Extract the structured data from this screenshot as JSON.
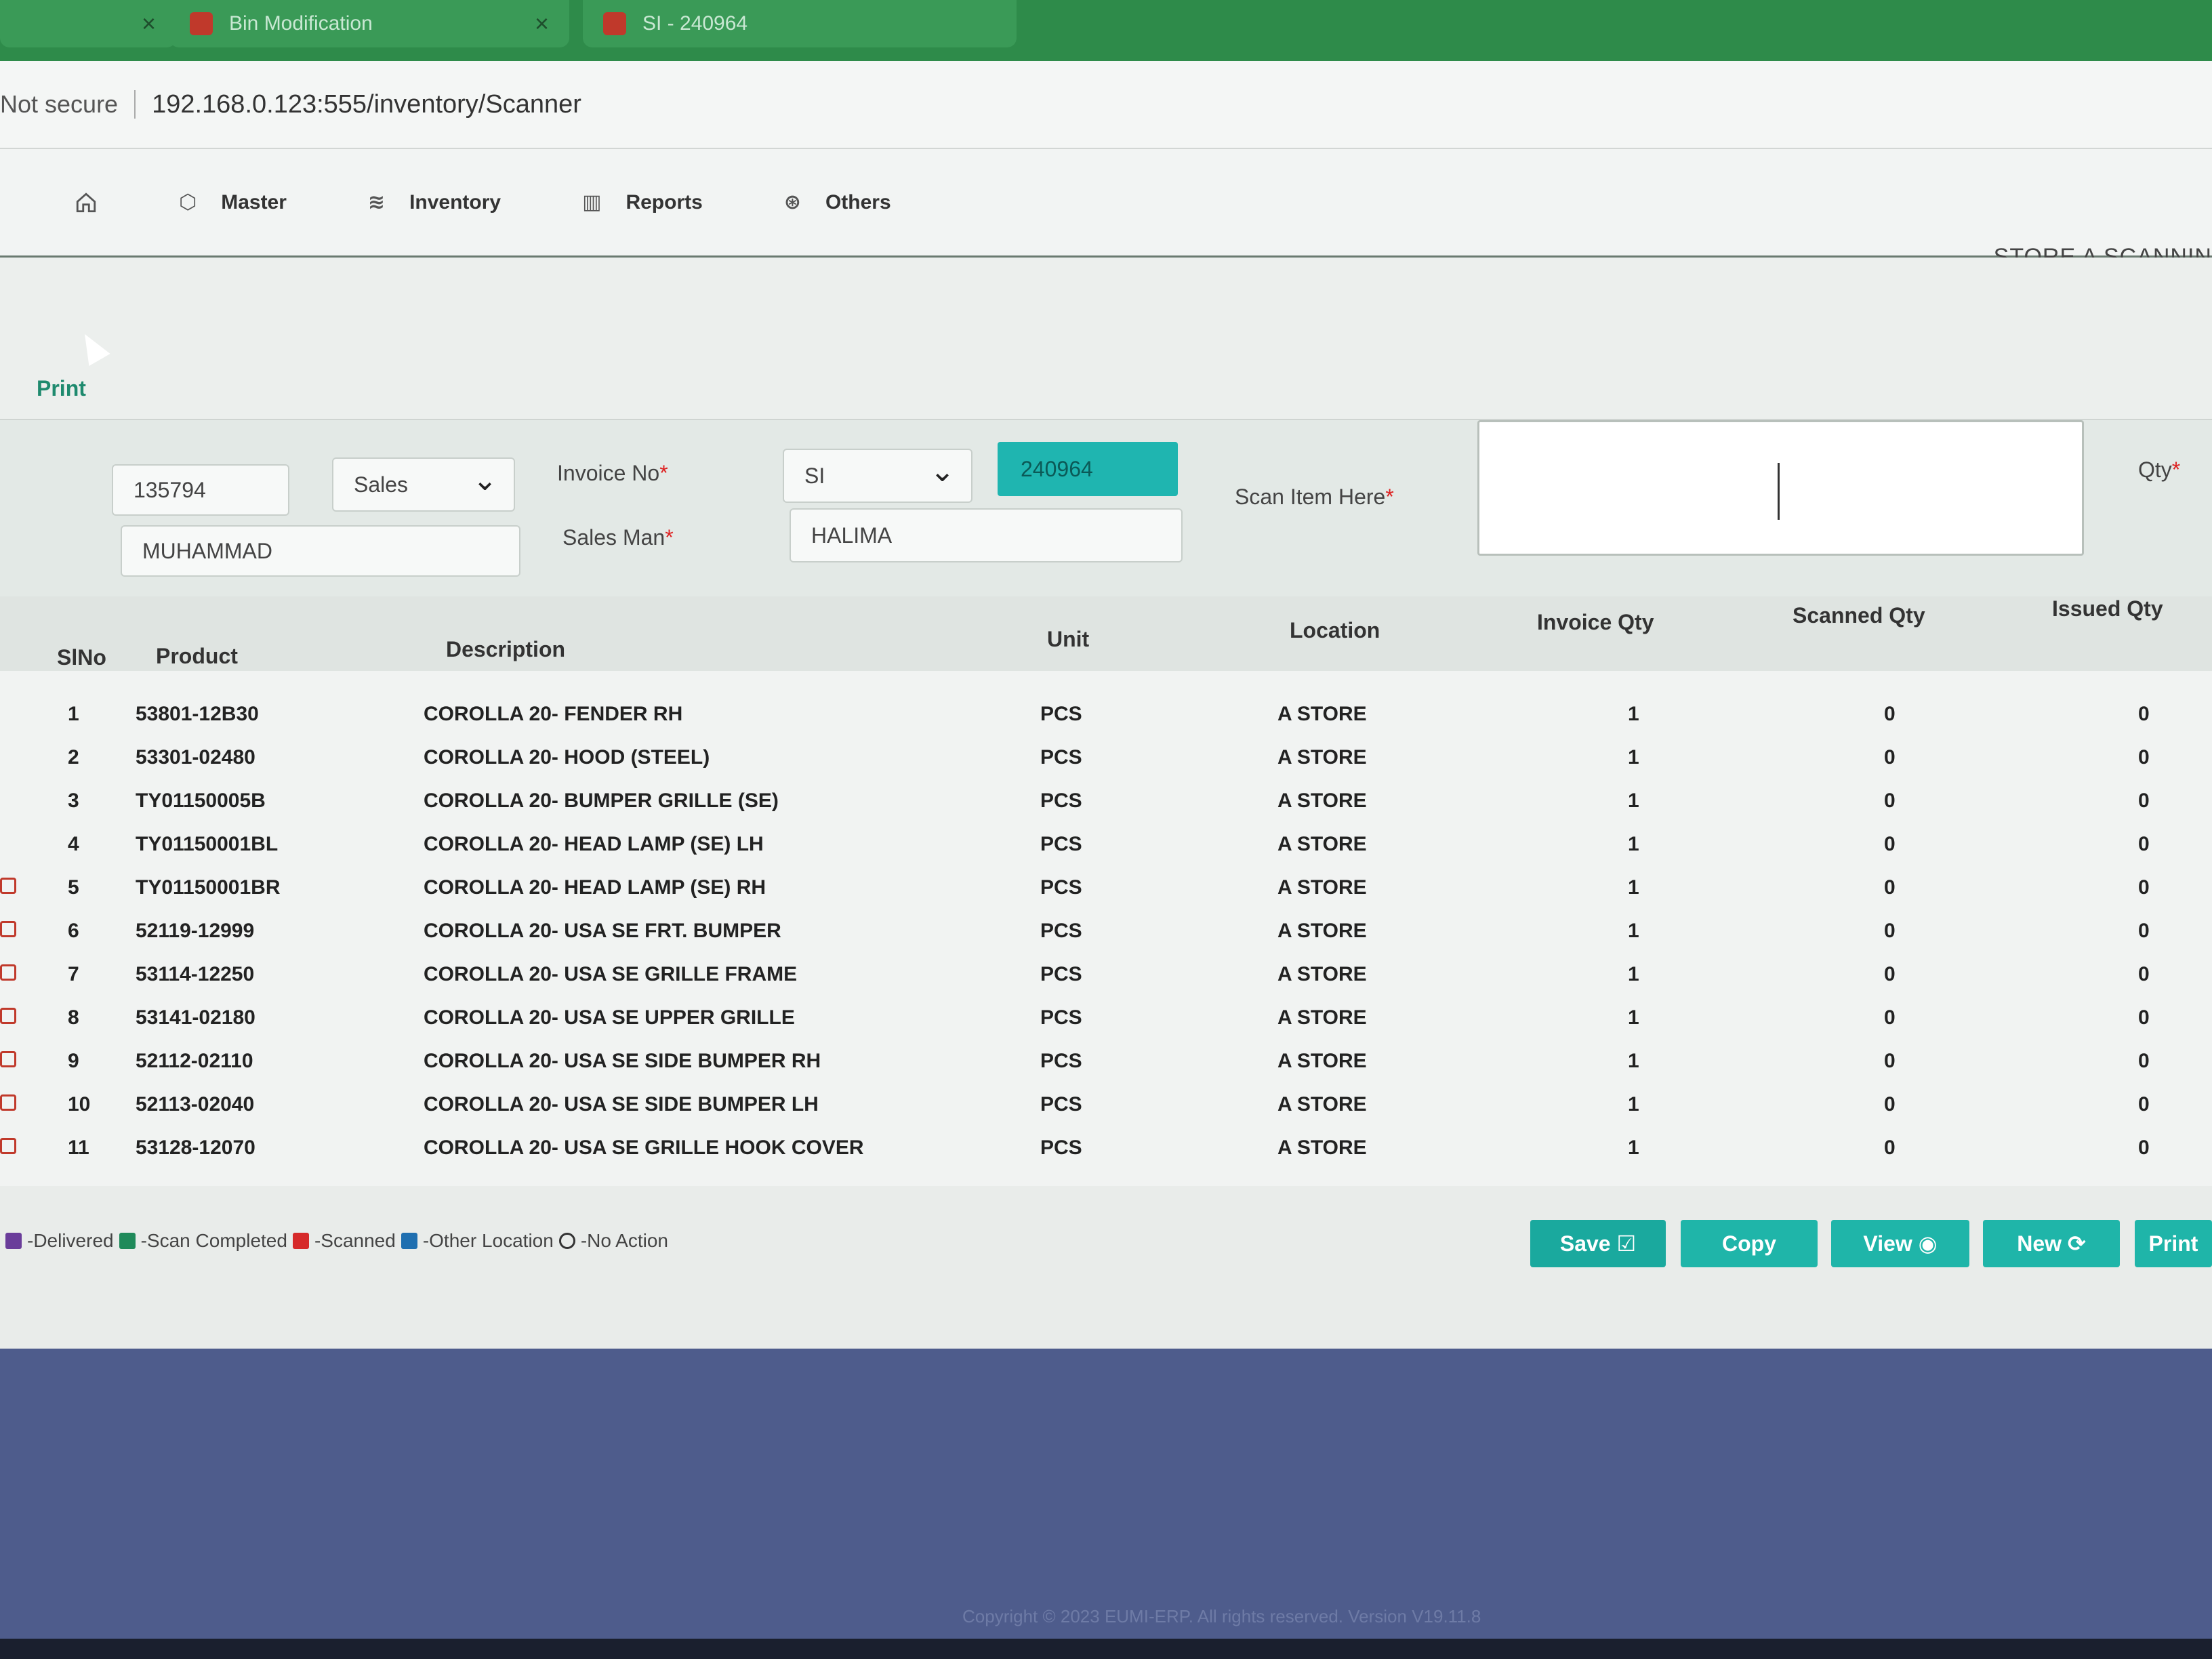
{
  "browser": {
    "tabs": [
      {
        "label": "",
        "close": "×"
      },
      {
        "label": "Bin Modification",
        "close": "×"
      },
      {
        "label": "SI - 240964",
        "close": ""
      }
    ],
    "security": "Not secure",
    "url": "192.168.0.123:555/inventory/Scanner"
  },
  "nav": {
    "home_icon": "home-icon",
    "items": [
      {
        "label": "Master",
        "icon": "cube-icon"
      },
      {
        "label": "Inventory",
        "icon": "layers-icon"
      },
      {
        "label": "Reports",
        "icon": "bar-chart-icon"
      },
      {
        "label": "Others",
        "icon": "grid-icon"
      }
    ],
    "store_title": "STORE A SCANNIN"
  },
  "print_link": "Print",
  "form": {
    "code": "135794",
    "type": "Sales",
    "customer": "MUHAMMAD",
    "invoice_label": "Invoice No",
    "invoice_prefix": "SI",
    "invoice_number": "240964",
    "salesman_label": "Sales Man",
    "salesman": "HALIMA",
    "scan_label": "Scan Item Here",
    "qty_label": "Qty",
    "required_mark": "*"
  },
  "table": {
    "headers": {
      "slno": "SlNo",
      "product": "Product",
      "description": "Description",
      "unit": "Unit",
      "location": "Location",
      "invoice_qty": "Invoice Qty",
      "scanned_qty": "Scanned Qty",
      "issued_qty": "Issued Qty"
    },
    "rows": [
      {
        "slno": "1",
        "product": "53801-12B30",
        "description": "COROLLA 20- FENDER RH",
        "unit": "PCS",
        "location": "A STORE",
        "invoice_qty": "1",
        "scanned_qty": "0",
        "issued_qty": "0"
      },
      {
        "slno": "2",
        "product": "53301-02480",
        "description": "COROLLA 20- HOOD (STEEL)",
        "unit": "PCS",
        "location": "A STORE",
        "invoice_qty": "1",
        "scanned_qty": "0",
        "issued_qty": "0"
      },
      {
        "slno": "3",
        "product": "TY01150005B",
        "description": "COROLLA 20- BUMPER GRILLE (SE)",
        "unit": "PCS",
        "location": "A STORE",
        "invoice_qty": "1",
        "scanned_qty": "0",
        "issued_qty": "0"
      },
      {
        "slno": "4",
        "product": "TY01150001BL",
        "description": "COROLLA 20- HEAD LAMP (SE) LH",
        "unit": "PCS",
        "location": "A STORE",
        "invoice_qty": "1",
        "scanned_qty": "0",
        "issued_qty": "0"
      },
      {
        "slno": "5",
        "product": "TY01150001BR",
        "description": "COROLLA 20- HEAD LAMP (SE) RH",
        "unit": "PCS",
        "location": "A STORE",
        "invoice_qty": "1",
        "scanned_qty": "0",
        "issued_qty": "0"
      },
      {
        "slno": "6",
        "product": "52119-12999",
        "description": "COROLLA 20- USA SE FRT. BUMPER",
        "unit": "PCS",
        "location": "A STORE",
        "invoice_qty": "1",
        "scanned_qty": "0",
        "issued_qty": "0"
      },
      {
        "slno": "7",
        "product": "53114-12250",
        "description": "COROLLA 20- USA SE GRILLE FRAME",
        "unit": "PCS",
        "location": "A STORE",
        "invoice_qty": "1",
        "scanned_qty": "0",
        "issued_qty": "0"
      },
      {
        "slno": "8",
        "product": "53141-02180",
        "description": "COROLLA 20- USA SE UPPER GRILLE",
        "unit": "PCS",
        "location": "A STORE",
        "invoice_qty": "1",
        "scanned_qty": "0",
        "issued_qty": "0"
      },
      {
        "slno": "9",
        "product": "52112-02110",
        "description": "COROLLA 20- USA SE SIDE BUMPER RH",
        "unit": "PCS",
        "location": "A STORE",
        "invoice_qty": "1",
        "scanned_qty": "0",
        "issued_qty": "0"
      },
      {
        "slno": "10",
        "product": "52113-02040",
        "description": "COROLLA 20- USA SE SIDE BUMPER LH",
        "unit": "PCS",
        "location": "A STORE",
        "invoice_qty": "1",
        "scanned_qty": "0",
        "issued_qty": "0"
      },
      {
        "slno": "11",
        "product": "53128-12070",
        "description": "COROLLA 20- USA SE GRILLE HOOK COVER",
        "unit": "PCS",
        "location": "A STORE",
        "invoice_qty": "1",
        "scanned_qty": "0",
        "issued_qty": "0"
      }
    ]
  },
  "legend": [
    {
      "label": "-Delivered",
      "color": "#6a3d9a"
    },
    {
      "label": "-Scan Completed",
      "color": "#1f8a5a"
    },
    {
      "label": "-Scanned",
      "color": "#d62a2a"
    },
    {
      "label": "-Other Location",
      "color": "#1f6fb0"
    },
    {
      "label": "-No Action",
      "color": "circle"
    }
  ],
  "buttons": {
    "save": "Save ☑",
    "copy": "Copy",
    "view": "View ◉",
    "new": "New ⟳",
    "print": "Print"
  },
  "footer": {
    "copyright": "Copyright © 2023 EUMI-ERP. All rights reserved. Version V19.11.8"
  }
}
